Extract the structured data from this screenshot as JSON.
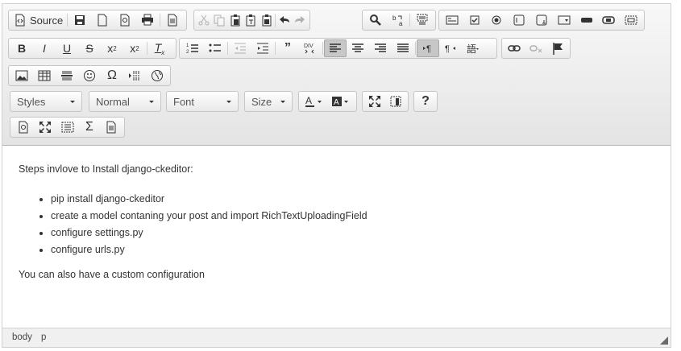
{
  "toolbar": {
    "source_label": "Source",
    "combo_styles": "Styles",
    "combo_format": "Normal",
    "combo_font": "Font",
    "combo_size": "Size",
    "help_label": "?"
  },
  "content": {
    "intro": "Steps invlove to Install django-ckeditor:",
    "list": [
      "pip install django-ckeditor",
      "create a model contaning your post and import RichTextUploadingField",
      "configure settings.py",
      "configure urls.py"
    ],
    "outro": "You can also have a custom configuration"
  },
  "statusbar": {
    "path": [
      "body",
      "p"
    ]
  },
  "colors": {
    "toolbar_top": "#f8f8f8",
    "toolbar_bottom": "#e4e4e4",
    "active": "#c7c7c7"
  }
}
